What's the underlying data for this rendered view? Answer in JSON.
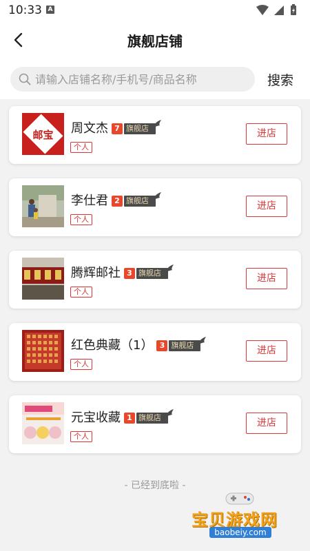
{
  "status_bar": {
    "time": "10:33",
    "notification_letter": "A"
  },
  "header": {
    "title": "旗舰店铺"
  },
  "search": {
    "placeholder": "请输入店铺名称/手机号/商品名称",
    "button_label": "搜索"
  },
  "stores": [
    {
      "name": "周文杰",
      "level": "7",
      "flag_label": "旗舰店",
      "tag": "个人",
      "enter_label": "进店",
      "thumb": "邮宝"
    },
    {
      "name": "李仕君",
      "level": "2",
      "flag_label": "旗舰店",
      "tag": "个人",
      "enter_label": "进店",
      "thumb": "photo"
    },
    {
      "name": "腾辉邮社",
      "level": "3",
      "flag_label": "旗舰店",
      "tag": "个人",
      "enter_label": "进店",
      "thumb": "sign"
    },
    {
      "name": "红色典藏（1）",
      "level": "3",
      "flag_label": "旗舰店",
      "tag": "个人",
      "enter_label": "进店",
      "thumb": "stamps"
    },
    {
      "name": "元宝收藏",
      "level": "1",
      "flag_label": "旗舰店",
      "tag": "个人",
      "enter_label": "进店",
      "thumb": "shop"
    }
  ],
  "footer": {
    "end_text": "- 已经到底啦 -"
  },
  "watermark": {
    "text": "宝贝游戏网",
    "url": "baobeiy.com"
  },
  "colors": {
    "accent": "#d9383a",
    "level_badge": "#e8472b",
    "flag_badge": "#4a4a4a",
    "background": "#f2f2f2"
  }
}
